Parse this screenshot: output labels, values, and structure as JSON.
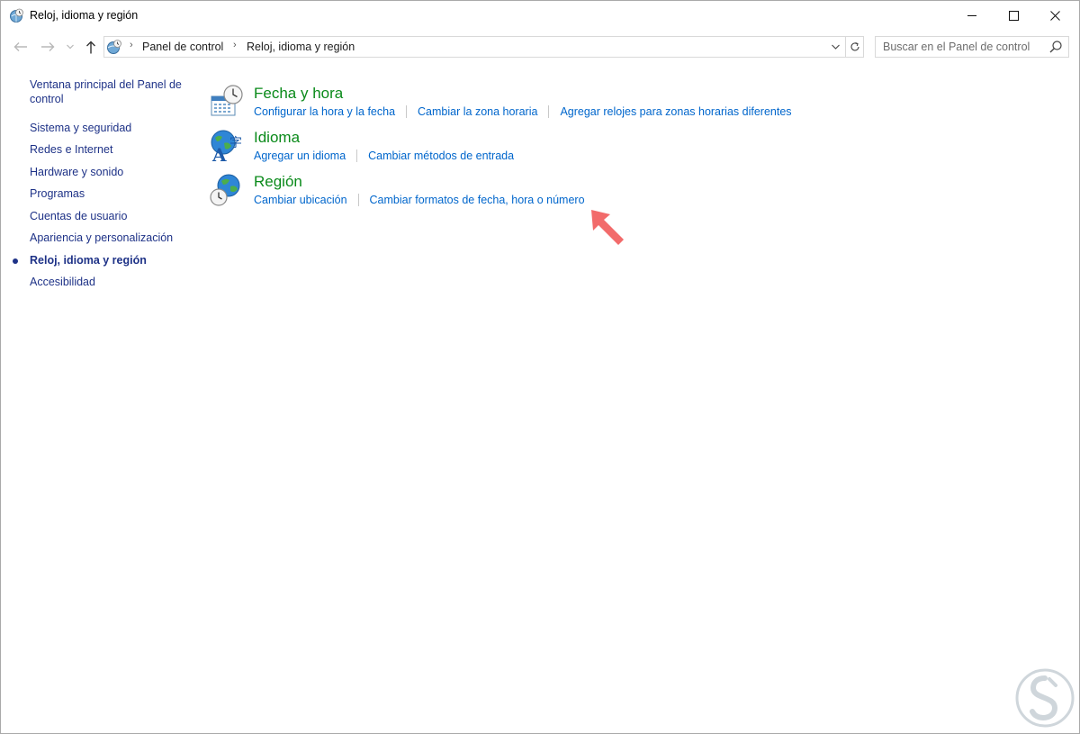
{
  "window": {
    "title": "Reloj, idioma y región"
  },
  "navigation": {
    "breadcrumb": [
      "Panel de control",
      "Reloj, idioma y región"
    ],
    "search_placeholder": "Buscar en el Panel de control"
  },
  "sidebar": {
    "items": [
      {
        "label": "Ventana principal del Panel de control",
        "current": false
      },
      {
        "label": "Sistema y seguridad",
        "current": false
      },
      {
        "label": "Redes e Internet",
        "current": false
      },
      {
        "label": "Hardware y sonido",
        "current": false
      },
      {
        "label": "Programas",
        "current": false
      },
      {
        "label": "Cuentas de usuario",
        "current": false
      },
      {
        "label": "Apariencia y personalización",
        "current": false
      },
      {
        "label": "Reloj, idioma y región",
        "current": true
      },
      {
        "label": "Accesibilidad",
        "current": false
      }
    ]
  },
  "categories": [
    {
      "title": "Fecha y hora",
      "icon": "calendar-clock-icon",
      "links": [
        "Configurar la hora y la fecha",
        "Cambiar la zona horaria",
        "Agregar relojes para zonas horarias diferentes"
      ]
    },
    {
      "title": "Idioma",
      "icon": "language-globe-icon",
      "links": [
        "Agregar un idioma",
        "Cambiar métodos de entrada"
      ]
    },
    {
      "title": "Región",
      "icon": "region-globe-icon",
      "links": [
        "Cambiar ubicación",
        "Cambiar formatos de fecha, hora o número"
      ]
    }
  ],
  "colors": {
    "category_title": "#0a8a1a",
    "link": "#0066cc",
    "sidebar_text": "#1e3287",
    "annotation_arrow": "#f26b6b"
  },
  "annotations": {
    "arrow_target": "Cambiar formatos de fecha, hora o número"
  }
}
